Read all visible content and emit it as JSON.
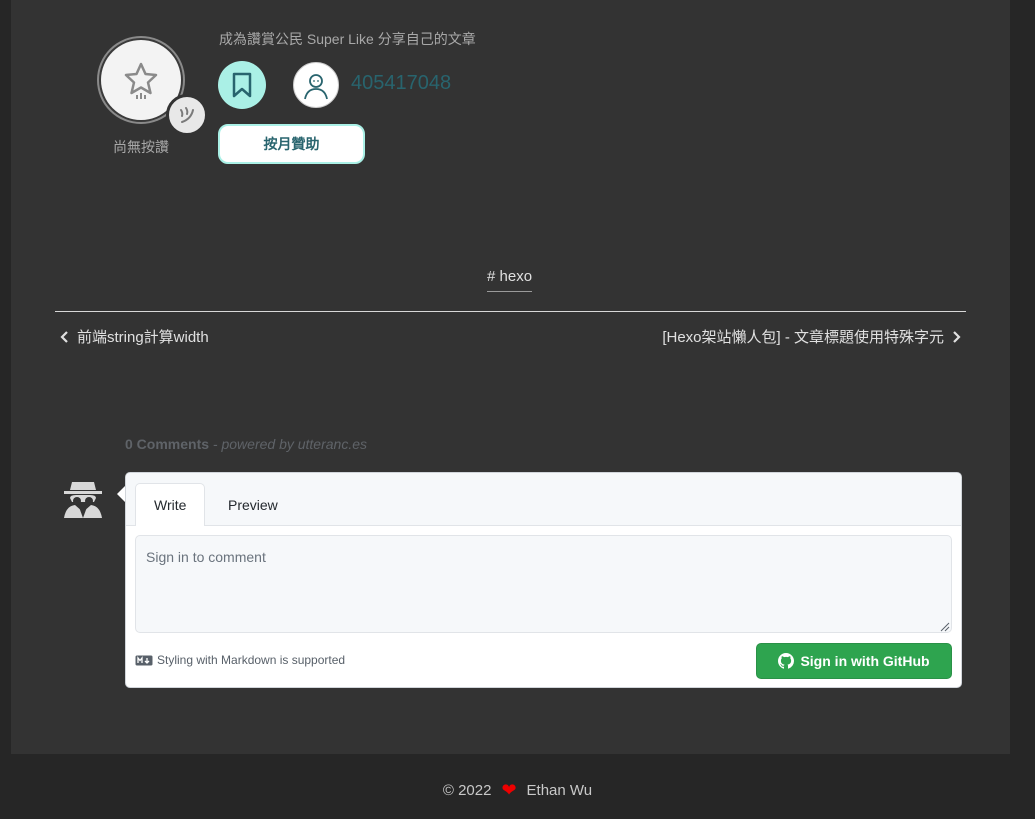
{
  "likecoin": {
    "civic_text": "成為讚賞公民 Super Like 分享自己的文章",
    "like_status": "尚無按讚",
    "author_id": "405417048",
    "sponsor_label": "按月贊助"
  },
  "post": {
    "tag": "# hexo",
    "prev_title": "前端string計算width",
    "next_title": "[Hexo架站懶人包] - 文章標題使用特殊字元"
  },
  "comments": {
    "count": "0 Comments",
    "powered": "- powered by utteranc.es",
    "tabs": [
      "Write",
      "Preview"
    ],
    "active_tab": "Write",
    "placeholder": "Sign in to comment",
    "markdown_note": "Styling with Markdown is supported",
    "signin_label": "Sign in with GitHub"
  },
  "footer": {
    "copyright": "© 2022",
    "author": "Ethan Wu"
  },
  "colors": {
    "panel": "#333333",
    "accent_teal": "#aaf0e6",
    "link_teal": "#28646e",
    "github_green": "#2ea44f",
    "heart": "#ee0000"
  }
}
